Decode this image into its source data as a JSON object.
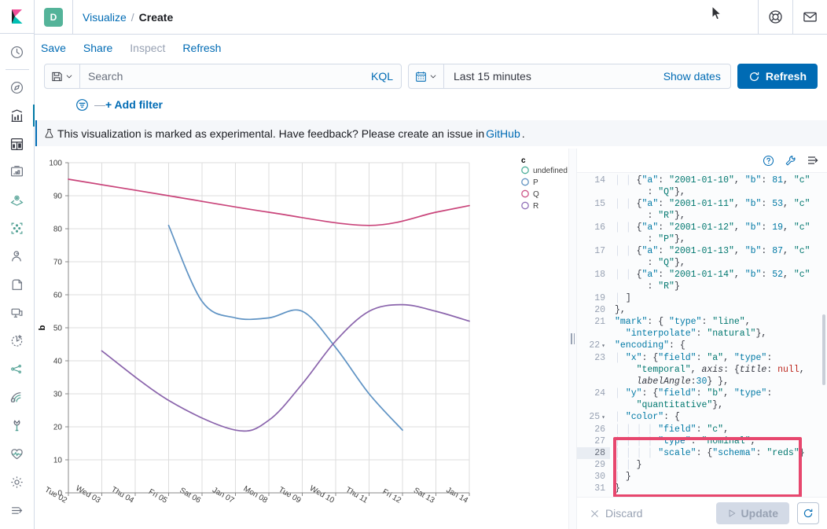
{
  "header": {
    "space_badge": "D",
    "breadcrumbs": [
      {
        "label": "Visualize",
        "last": false
      },
      {
        "label": "Create",
        "last": true
      }
    ],
    "crumb_separator": "/",
    "right_icons": [
      {
        "name": "help-lifering-icon"
      },
      {
        "name": "news-mail-icon"
      }
    ]
  },
  "actions": {
    "save": "Save",
    "share": "Share",
    "inspect": "Inspect",
    "refresh": "Refresh"
  },
  "query": {
    "saved_query_icon": "save-disk-icon",
    "search_placeholder": "Search",
    "search_value": "",
    "kql_label": "KQL",
    "calendar_icon": "calendar-icon",
    "time_range": "Last 15 minutes",
    "show_dates": "Show dates",
    "refresh_button": "Refresh"
  },
  "filters": {
    "add_filter": "+ Add filter",
    "dash": "—"
  },
  "callout": {
    "text_before": "This visualization is marked as experimental. Have feedback? Please create an issue in ",
    "link": "GitHub",
    "text_after": ".",
    "icon": "flask-icon"
  },
  "sidebar": {
    "items": [
      {
        "name": "recently-viewed-icon",
        "label": "Recently viewed",
        "selected": false
      },
      {
        "name": "discover-compass-icon",
        "label": "Discover",
        "selected": false
      },
      {
        "name": "visualize-bar-chart-icon",
        "label": "Visualize",
        "selected": true
      },
      {
        "name": "dashboard-icon",
        "label": "Dashboard",
        "selected": false
      },
      {
        "name": "canvas-icon",
        "label": "Canvas",
        "selected": false
      },
      {
        "name": "maps-icon",
        "label": "Maps",
        "selected": false
      },
      {
        "name": "machine-learning-icon",
        "label": "Machine Learning",
        "selected": false
      },
      {
        "name": "infrastructure-icon",
        "label": "Infrastructure",
        "selected": false
      },
      {
        "name": "logs-icon",
        "label": "Logs",
        "selected": false
      },
      {
        "name": "apm-monitor-icon",
        "label": "APM",
        "selected": false
      },
      {
        "name": "uptime-icon",
        "label": "Uptime",
        "selected": false
      },
      {
        "name": "siem-graph-icon",
        "label": "SIEM",
        "selected": false
      },
      {
        "name": "apm-signal-icon",
        "label": "APM Signal",
        "selected": false
      },
      {
        "name": "dev-tools-wrench-icon",
        "label": "Dev Tools",
        "selected": false
      },
      {
        "name": "stack-monitoring-heart-icon",
        "label": "Stack Monitoring",
        "selected": false
      },
      {
        "name": "management-gear-icon",
        "label": "Management",
        "selected": false
      },
      {
        "name": "collapse-nav-icon",
        "label": "Collapse",
        "selected": false
      }
    ]
  },
  "editor": {
    "toolbar_icons": [
      {
        "name": "help-question-icon"
      },
      {
        "name": "wrench-icon"
      },
      {
        "name": "editor-options-icon"
      }
    ],
    "footer": {
      "discard": "Discard",
      "update": "Update",
      "refresh_icon": "auto-refresh-icon"
    },
    "highlighted_lines": [
      25,
      26,
      27,
      28,
      29
    ],
    "active_line": 28,
    "lines": [
      {
        "num": "14",
        "indent": 2,
        "text": "{\"a\": \"2001-01-10\", \"b\": 81, \"c\""
      },
      {
        "num": "",
        "indent": 0,
        "text": "      : \"Q\"},",
        "cont": true
      },
      {
        "num": "15",
        "indent": 2,
        "text": "{\"a\": \"2001-01-11\", \"b\": 53, \"c\""
      },
      {
        "num": "",
        "indent": 0,
        "text": "      : \"R\"},",
        "cont": true
      },
      {
        "num": "16",
        "indent": 2,
        "text": "{\"a\": \"2001-01-12\", \"b\": 19, \"c\""
      },
      {
        "num": "",
        "indent": 0,
        "text": "      : \"P\"},",
        "cont": true
      },
      {
        "num": "17",
        "indent": 2,
        "text": "{\"a\": \"2001-01-13\", \"b\": 87, \"c\""
      },
      {
        "num": "",
        "indent": 0,
        "text": "      : \"Q\"},",
        "cont": true
      },
      {
        "num": "18",
        "indent": 2,
        "text": "{\"a\": \"2001-01-14\", \"b\": 52, \"c\""
      },
      {
        "num": "",
        "indent": 0,
        "text": "      : \"R\"}",
        "cont": true
      },
      {
        "num": "19",
        "indent": 1,
        "text": "]"
      },
      {
        "num": "20",
        "indent": 0,
        "text": "},"
      },
      {
        "num": "21",
        "indent": 0,
        "text": "\"mark\": { \"type\": \"line\","
      },
      {
        "num": "",
        "indent": 0,
        "text": "  \"interpolate\": \"natural\"},",
        "cont": true
      },
      {
        "num": "22",
        "indent": 0,
        "text": "\"encoding\": {",
        "fold": true
      },
      {
        "num": "23",
        "indent": 1,
        "text": "\"x\": {\"field\": \"a\", \"type\":"
      },
      {
        "num": "",
        "indent": 0,
        "text": "    \"temporal\", axis: {title: null,",
        "cont": true
      },
      {
        "num": "",
        "indent": 0,
        "text": "    labelAngle:30} },",
        "cont": true
      },
      {
        "num": "24",
        "indent": 1,
        "text": "\"y\": {\"field\": \"b\", \"type\":"
      },
      {
        "num": "",
        "indent": 0,
        "text": "    \"quantitative\"},",
        "cont": true
      },
      {
        "num": "25",
        "indent": 1,
        "text": "\"color\": {",
        "fold": true
      },
      {
        "num": "26",
        "indent": 4,
        "text": "\"field\": \"c\","
      },
      {
        "num": "27",
        "indent": 4,
        "text": "\"type\": \"nominal\","
      },
      {
        "num": "28",
        "indent": 4,
        "text": "\"scale\": {\"schema\": \"reds\"}"
      },
      {
        "num": "29",
        "indent": 2,
        "text": "}"
      },
      {
        "num": "30",
        "indent": 1,
        "text": "}"
      },
      {
        "num": "31",
        "indent": 0,
        "text": "}"
      }
    ]
  },
  "chart_data": {
    "type": "line",
    "title": "",
    "xlabel": "",
    "ylabel": "b",
    "ylim": [
      0,
      100
    ],
    "yticks": [
      0,
      10,
      20,
      30,
      40,
      50,
      60,
      70,
      80,
      90,
      100
    ],
    "xticks": [
      "Tue 02",
      "Wed 03",
      "Thu 04",
      "Fri 05",
      "Sat 06",
      "Jan 07",
      "Mon 08",
      "Tue 09",
      "Wed 10",
      "Thu 11",
      "Fri 12",
      "Sat 13",
      "Jan 14"
    ],
    "x_label_angle": 30,
    "grid": true,
    "interpolate": "natural",
    "legend": {
      "title": "c",
      "position": "right",
      "entries": [
        {
          "label": "undefined",
          "color": "#4daf9a"
        },
        {
          "label": "P",
          "color": "#6092c0"
        },
        {
          "label": "Q",
          "color": "#cc5285"
        },
        {
          "label": "R",
          "color": "#9170b8"
        }
      ]
    },
    "series": [
      {
        "name": "Q",
        "color": "#c9447a",
        "points": [
          {
            "x": "Tue 02",
            "y": 95
          },
          {
            "x": "Fri 05",
            "y": 90
          },
          {
            "x": "Mon 08",
            "y": 85
          },
          {
            "x": "Thu 11",
            "y": 81
          },
          {
            "x": "Sat 13",
            "y": 85
          },
          {
            "x": "Jan 14",
            "y": 87
          }
        ]
      },
      {
        "name": "P",
        "color": "#5f93c4",
        "points": [
          {
            "x": "Fri 05",
            "y": 81
          },
          {
            "x": "Sat 06",
            "y": 58
          },
          {
            "x": "Jan 07",
            "y": 53
          },
          {
            "x": "Mon 08",
            "y": 53
          },
          {
            "x": "Tue 09",
            "y": 55
          },
          {
            "x": "Wed 10",
            "y": 44
          },
          {
            "x": "Thu 11",
            "y": 30
          },
          {
            "x": "Fri 12",
            "y": 19
          }
        ]
      },
      {
        "name": "R",
        "color": "#8a64ac",
        "points": [
          {
            "x": "Wed 03",
            "y": 43
          },
          {
            "x": "Fri 05",
            "y": 28
          },
          {
            "x": "Jan 07",
            "y": 19
          },
          {
            "x": "Mon 08",
            "y": 22
          },
          {
            "x": "Tue 09",
            "y": 33
          },
          {
            "x": "Wed 10",
            "y": 46
          },
          {
            "x": "Thu 11",
            "y": 55
          },
          {
            "x": "Fri 12",
            "y": 57
          },
          {
            "x": "Sat 13",
            "y": 55
          },
          {
            "x": "Jan 14",
            "y": 52
          }
        ]
      }
    ]
  },
  "colors": {
    "accent": "#006bb4",
    "highlight_box": "#e7476e",
    "badge": "#54b399"
  }
}
